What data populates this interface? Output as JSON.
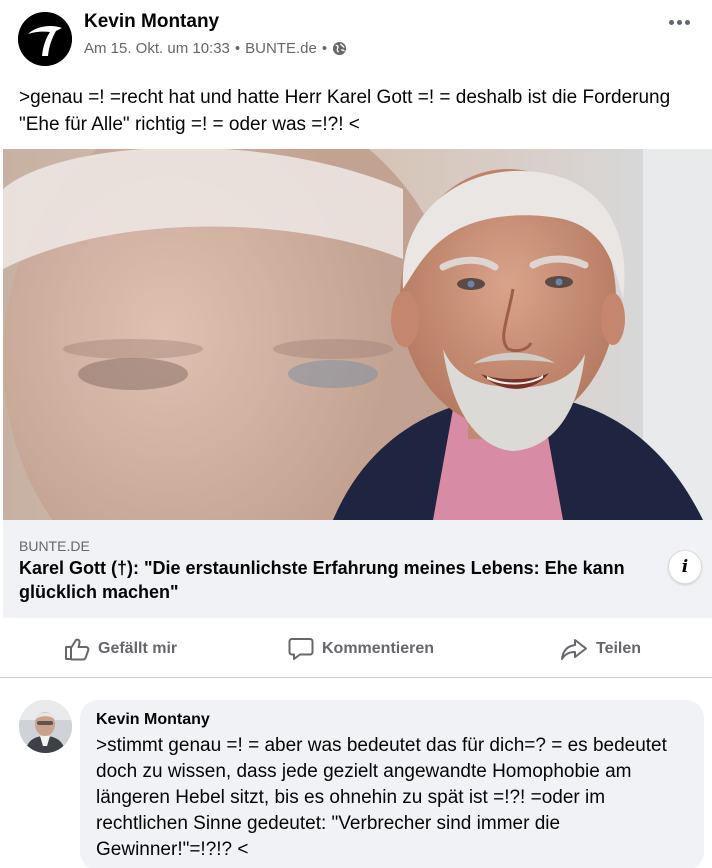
{
  "post": {
    "author": "Kevin Montany",
    "timestamp": "Am 15. Okt. um 10:33",
    "separator": "•",
    "source": "BUNTE.de",
    "privacy_icon": "globe-icon",
    "more_icon": "more-options-icon",
    "text": ">genau =! =recht hat und hatte Herr Karel Gott =! = deshalb ist die Forderung \"Ehe für Alle\" richtig =! = oder was =!?! <"
  },
  "link": {
    "domain": "BUNTE.DE",
    "title": "Karel Gott (†): \"Die erstaunlichste Erfahrung meines Lebens: Ehe kann glücklich machen\"",
    "info_label": "i"
  },
  "actions": {
    "like_label": "Gefällt mir",
    "comment_label": "Kommentieren",
    "share_label": "Teilen"
  },
  "comment": {
    "author": "Kevin Montany",
    "text": ">stimmt genau =! = aber was bedeutet das für dich=? = es bedeutet doch zu wissen, dass jede gezielt angewandte Homophobie am längeren Hebel sitzt, bis es ohnehin zu spät ist =!?! =oder im rechtlichen Sinne gedeutet: \"Verbrecher sind immer die Gewinner!\"=!?!? <"
  },
  "colors": {
    "secondary_text": "#65676b",
    "bubble_bg": "#f0f2f5",
    "divider": "#ced0d4"
  }
}
